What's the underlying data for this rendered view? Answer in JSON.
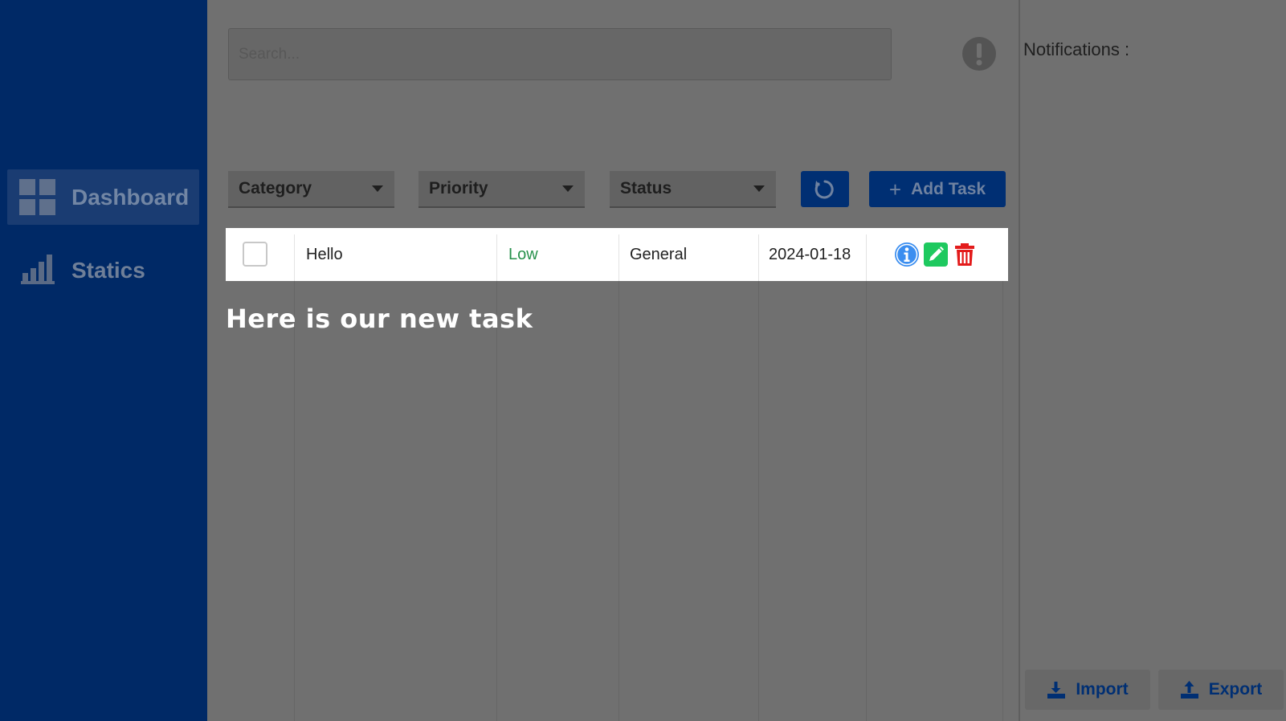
{
  "sidebar": {
    "items": [
      {
        "label": "Dashboard",
        "icon": "dashboard-grid-icon",
        "active": true
      },
      {
        "label": "Statics",
        "icon": "bar-chart-icon",
        "active": false
      }
    ]
  },
  "search": {
    "placeholder": "Search..."
  },
  "filters": {
    "category_label": "Category",
    "priority_label": "Priority",
    "status_label": "Status"
  },
  "toolbar": {
    "add_task_label": "Add Task",
    "add_icon": "+",
    "refresh_icon": "refresh-icon"
  },
  "tasks": [
    {
      "title": "Hello",
      "priority": "Low",
      "category": "General",
      "date": "2024-01-18",
      "completed": false
    }
  ],
  "annotation": "Here is our new task",
  "notifications": {
    "title": "Notifications :"
  },
  "footer": {
    "import_label": "Import",
    "export_label": "Export"
  },
  "colors": {
    "sidebar": "#002966",
    "accent": "#002f73",
    "priority_low": "#27914b",
    "info": "#3b8ef0",
    "edit": "#1ec95f",
    "delete": "#e31b1b"
  }
}
